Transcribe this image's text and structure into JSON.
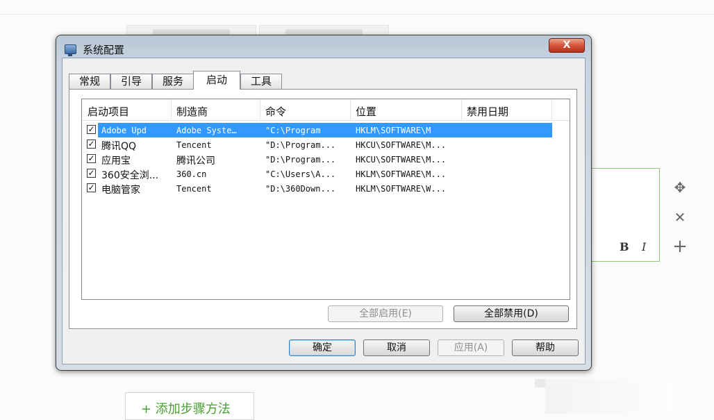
{
  "background": {
    "add_step_label": "+ 添加步骤方法",
    "bold_label": "B",
    "italic_label": "I",
    "tools": [
      {
        "icon": "move-icon",
        "glyph": "✥"
      },
      {
        "icon": "close-icon",
        "glyph": "✕"
      },
      {
        "icon": "plus-icon",
        "glyph": "+"
      }
    ]
  },
  "dialog": {
    "title": "系统配置",
    "close_label": "X",
    "tabs": [
      "常规",
      "引导",
      "服务",
      "启动",
      "工具"
    ],
    "active_tab": "启动",
    "columns": [
      "启动项目",
      "制造商",
      "命令",
      "位置",
      "禁用日期"
    ],
    "rows": [
      {
        "checked": true,
        "selected": true,
        "item": "Adobe Upd",
        "maker": "Adobe Syste…",
        "command": "\"C:\\Program",
        "location": "HKLM\\SOFTWARE\\M",
        "date": ""
      },
      {
        "checked": true,
        "selected": false,
        "item": "腾讯QQ",
        "maker": "Tencent",
        "command": "\"D:\\Program...",
        "location": "HKCU\\SOFTWARE\\M...",
        "date": ""
      },
      {
        "checked": true,
        "selected": false,
        "item": "应用宝",
        "maker": "腾讯公司",
        "command": "\"D:\\Program...",
        "location": "HKCU\\SOFTWARE\\M...",
        "date": ""
      },
      {
        "checked": true,
        "selected": false,
        "item": "360安全浏...",
        "maker": "360.cn",
        "command": "\"C:\\Users\\A...",
        "location": "HKLM\\SOFTWARE\\M...",
        "date": ""
      },
      {
        "checked": true,
        "selected": false,
        "item": "电脑管家",
        "maker": "Tencent",
        "command": "\"D:\\360Down...",
        "location": "HKLM\\SOFTWARE\\W...",
        "date": ""
      }
    ],
    "check_mark": "✓",
    "enable_all_label": "全部启用(E)",
    "disable_all_label": "全部禁用(D)",
    "ok_label": "确定",
    "cancel_label": "取消",
    "apply_label": "应用(A)",
    "help_label": "帮助"
  }
}
